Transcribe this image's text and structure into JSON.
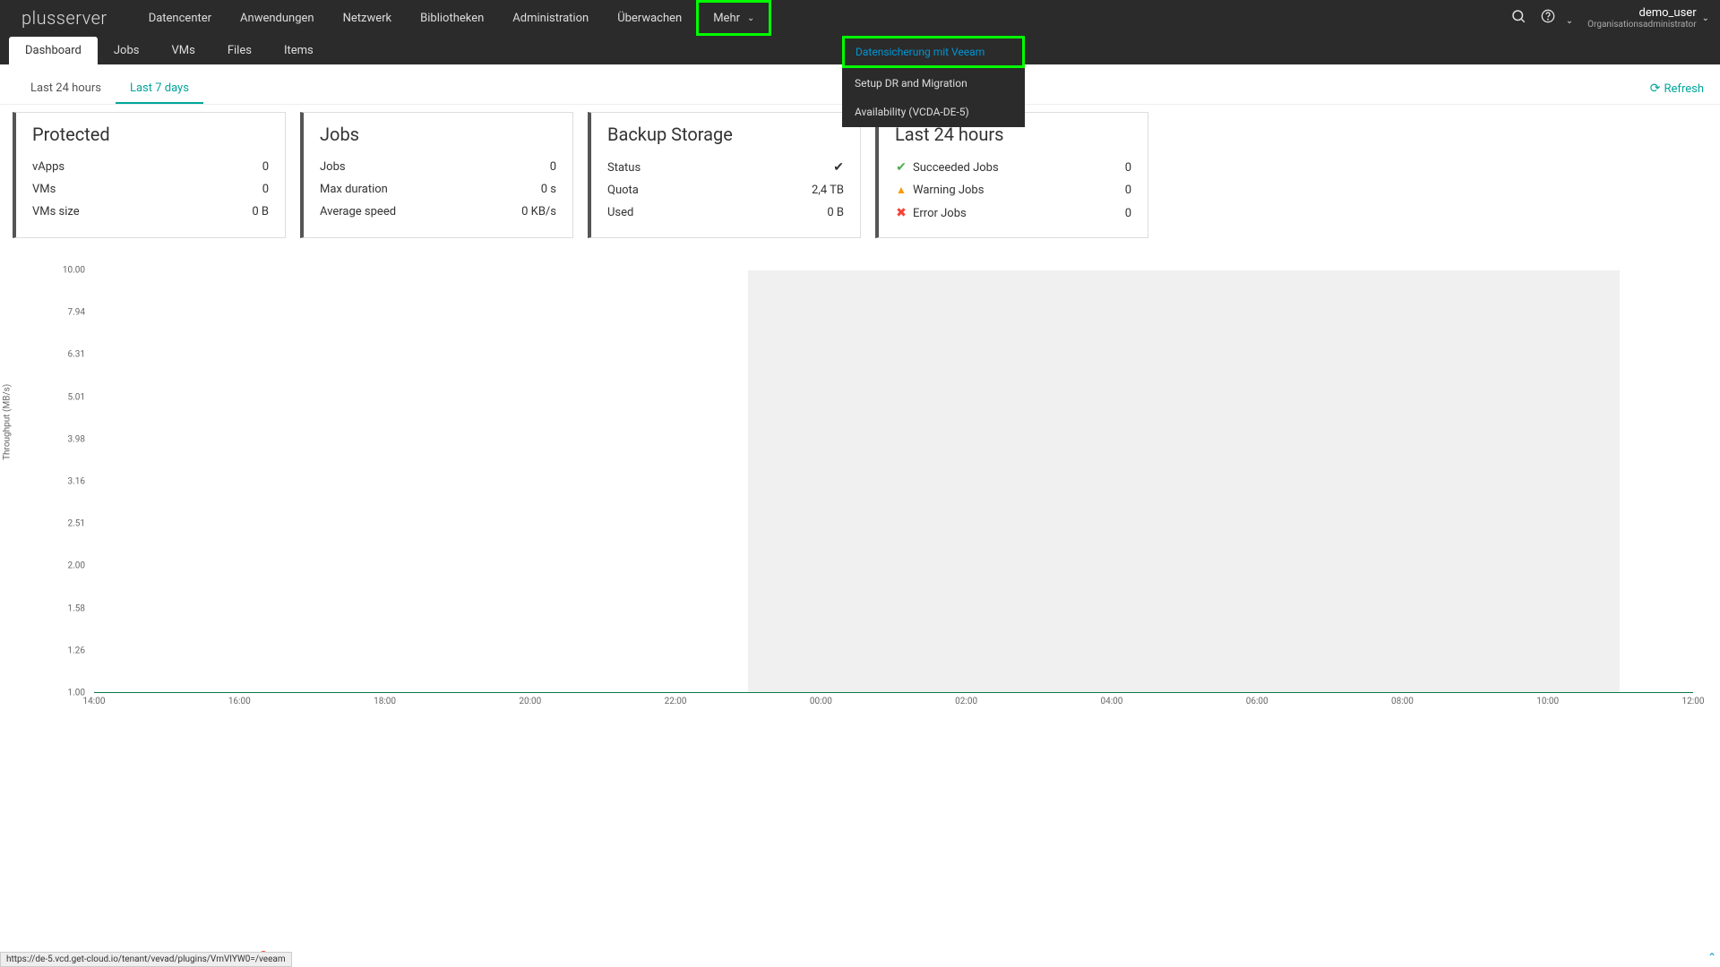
{
  "brand": "plusserver",
  "nav": {
    "items": [
      "Datencenter",
      "Anwendungen",
      "Netzwerk",
      "Bibliotheken",
      "Administration",
      "Überwachen"
    ],
    "more_label": "Mehr"
  },
  "dropdown": {
    "items": [
      "Datensicherung mit Veeam",
      "Setup DR and Migration",
      "Availability (VCDA-DE-5)"
    ]
  },
  "user": {
    "name": "demo_user",
    "role": "Organisationsadministrator"
  },
  "subtabs": [
    "Dashboard",
    "Jobs",
    "VMs",
    "Files",
    "Items"
  ],
  "timetabs": {
    "t1": "Last 24 hours",
    "t2": "Last 7 days"
  },
  "refresh_label": "Refresh",
  "cards": {
    "protected": {
      "title": "Protected",
      "rows": [
        {
          "label": "vApps",
          "value": "0"
        },
        {
          "label": "VMs",
          "value": "0"
        },
        {
          "label": "VMs size",
          "value": "0 B"
        }
      ]
    },
    "jobs": {
      "title": "Jobs",
      "rows": [
        {
          "label": "Jobs",
          "value": "0"
        },
        {
          "label": "Max duration",
          "value": "0 s"
        },
        {
          "label": "Average speed",
          "value": "0 KB/s"
        }
      ]
    },
    "storage": {
      "title": "Backup Storage",
      "rows": [
        {
          "label": "Status",
          "value": "ok"
        },
        {
          "label": "Quota",
          "value": "2,4 TB"
        },
        {
          "label": "Used",
          "value": "0 B"
        }
      ]
    },
    "last24": {
      "title": "Last 24 hours",
      "rows": [
        {
          "icon": "ok",
          "label": "Succeeded Jobs",
          "value": "0"
        },
        {
          "icon": "warn",
          "label": "Warning Jobs",
          "value": "0"
        },
        {
          "icon": "err",
          "label": "Error Jobs",
          "value": "0"
        }
      ]
    }
  },
  "chart_data": {
    "type": "line",
    "ylabel": "Throughput (MB/s)",
    "yticks": [
      "10.00",
      "7.94",
      "6.31",
      "5.01",
      "3.98",
      "3.16",
      "2.51",
      "2.00",
      "1.58",
      "1.26",
      "1.00"
    ],
    "xticks": [
      "14:00",
      "16:00",
      "18:00",
      "20:00",
      "22:00",
      "00:00",
      "02:00",
      "04:00",
      "06:00",
      "08:00",
      "10:00",
      "12:00"
    ],
    "series": [
      {
        "name": "throughput",
        "values": [
          0,
          0,
          0,
          0,
          0,
          0,
          0,
          0,
          0,
          0,
          0,
          0
        ]
      }
    ],
    "ylim": [
      1.0,
      10.0
    ]
  },
  "statusbar_url": "https://de-5.vcd.get-cloud.io/tenant/vevad/plugins/VmVlYW0=/veeam",
  "legend_dot": "●"
}
